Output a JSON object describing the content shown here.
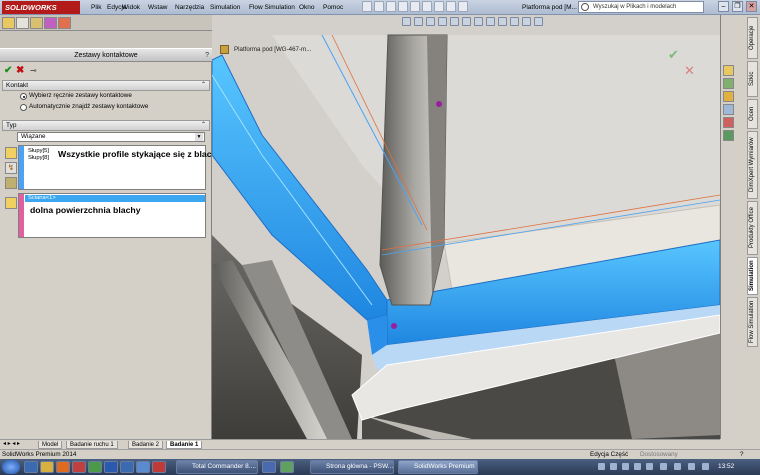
{
  "titlebar": {
    "logo": "SOLIDWORKS",
    "menu": [
      "Plik",
      "Edycja",
      "Widok",
      "Wstaw",
      "Narzędzia",
      "Simulation",
      "Flow Simulation",
      "Okno",
      "Pomoc"
    ],
    "doc_title": "Platforma pod [M...",
    "search_placeholder": "Wyszukaj w Plikach i modelach",
    "minimize": "–",
    "restore": "❐",
    "close": "✕"
  },
  "property_manager": {
    "title": "Zestawy kontaktowe",
    "help": "?",
    "section_contact": "Kontakt",
    "radio_manual": "Wybierz ręcznie zestawy kontaktowe",
    "radio_auto": "Automatycznie znajdź zestawy kontaktowe",
    "section_type": "Typ",
    "type_value": "Wiązane",
    "set1_items": [
      "Słupy[5]",
      "Słupy[8]"
    ],
    "set1_annotation": "Wszystkie profile stykające się z blachą",
    "set2_items": [
      "Ściana<1>"
    ],
    "set2_annotation": "dolna powierzchnia blachy",
    "collapse": "⌃"
  },
  "viewport": {
    "tree_label": "Platforma pod [WG-467-m..."
  },
  "task_pane": {
    "tabs": [
      "Operacje",
      "Szkic",
      "Ocen",
      "DimXpert Wymiarów",
      "Produkty Office",
      "Simulation",
      "Flow Simulation"
    ]
  },
  "bottom_tabs": [
    "Model",
    "Badanie ruchu 1",
    "Badanie 2",
    "Badanie 1"
  ],
  "status": {
    "left": "SolidWorks Premium 2014",
    "edit": "Edycja Część",
    "custom": "Dostosowany"
  },
  "taskbar": {
    "buttons": [
      "Total Commander 8....",
      "Strona główna - PSW...",
      "SolidWorks Premium ..."
    ],
    "clock": "13:52"
  },
  "colors": {
    "accent_blue": "#3aa7f0",
    "brand_red": "#b31b1b",
    "ok_green": "#1b8f1b",
    "cancel_red": "#c01010"
  }
}
